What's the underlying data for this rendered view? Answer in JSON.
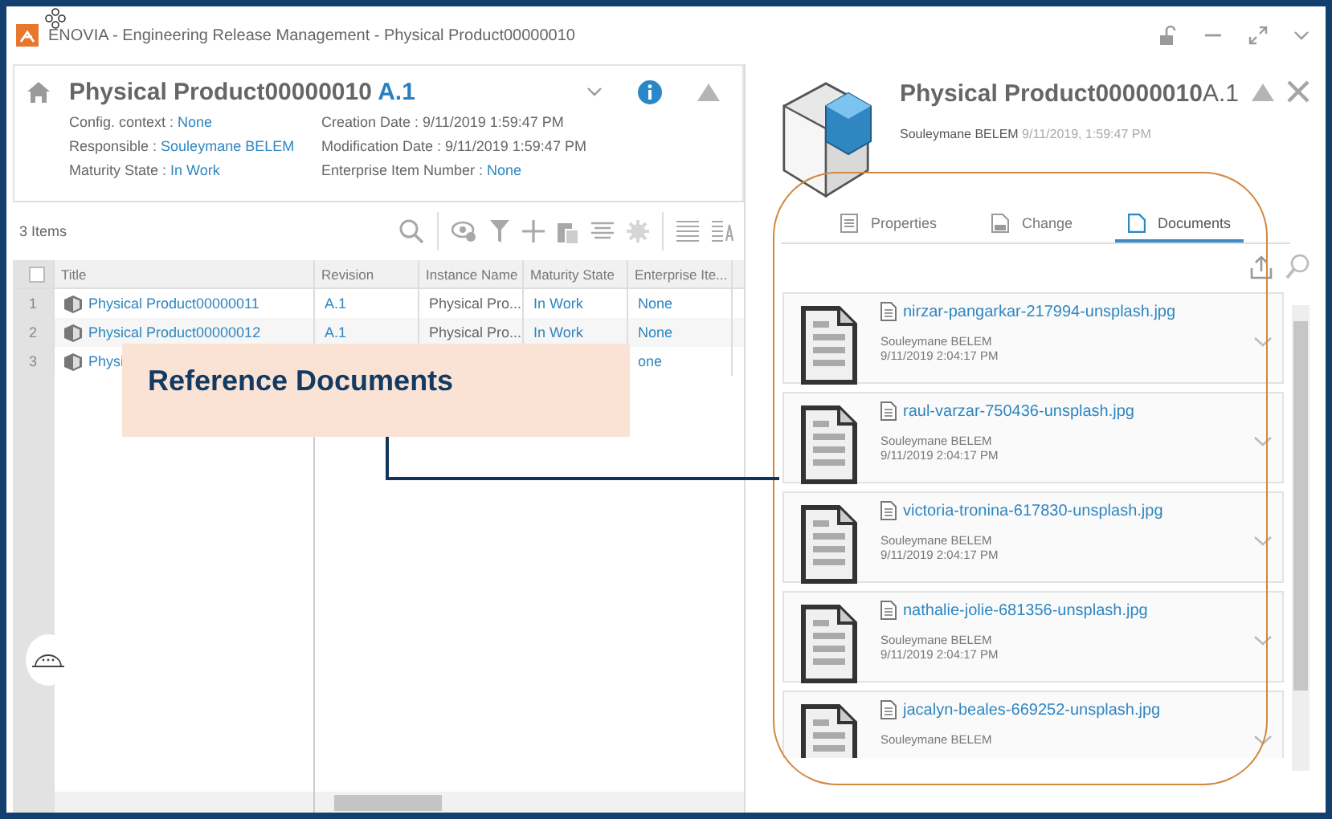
{
  "window": {
    "title": "ENOVIA - Engineering Release Management - Physical Product00000010"
  },
  "object_header": {
    "name": "Physical Product00000010",
    "revision": "A.1",
    "attributes": [
      {
        "label": "Config. context :",
        "value": "None",
        "kind": "link"
      },
      {
        "label": "Creation Date :",
        "value": "9/11/2019 1:59:47 PM",
        "kind": "text"
      },
      {
        "label": "Responsible :",
        "value": "Souleymane BELEM",
        "kind": "link"
      },
      {
        "label": "Modification Date :",
        "value": "9/11/2019 1:59:47 PM",
        "kind": "text"
      },
      {
        "label": "Maturity State :",
        "value": "In Work",
        "kind": "link"
      },
      {
        "label": "Enterprise Item Number :",
        "value": "None",
        "kind": "link"
      }
    ]
  },
  "toolbar": {
    "count": "3 Items"
  },
  "table": {
    "header_checked": false,
    "columns": [
      "Title",
      "Revision",
      "Instance Name",
      "Maturity State",
      "Enterprise Ite..."
    ],
    "rows": [
      {
        "number": "1",
        "cells": [
          "Physical Product00000011",
          "A.1",
          "Physical Pro...",
          "In Work",
          "None"
        ]
      },
      {
        "number": "2",
        "cells": [
          "Physical Product00000012",
          "A.1",
          "Physical Pro...",
          "In Work",
          "None"
        ]
      },
      {
        "number": "3",
        "cells": [
          "Physi",
          null,
          null,
          null,
          "one"
        ]
      }
    ]
  },
  "details_panel": {
    "name": "Physical Product00000010",
    "revision": "A.1",
    "author": "Souleymane BELEM",
    "date": "9/11/2019, 1:59:47 PM"
  },
  "tabs": [
    {
      "label": "Properties",
      "selected": false,
      "kind": "list"
    },
    {
      "label": "Change",
      "selected": false,
      "kind": "page"
    },
    {
      "label": "Documents",
      "selected": true,
      "kind": "doc"
    }
  ],
  "documents": [
    {
      "name": "nirzar-pangarkar-217994-unsplash.jpg",
      "author": "Souleymane BELEM",
      "date": "9/11/2019 2:04:17 PM"
    },
    {
      "name": "raul-varzar-750436-unsplash.jpg",
      "author": "Souleymane BELEM",
      "date": "9/11/2019 2:04:17 PM"
    },
    {
      "name": "victoria-tronina-617830-unsplash.jpg",
      "author": "Souleymane BELEM",
      "date": "9/11/2019 2:04:17 PM"
    },
    {
      "name": "nathalie-jolie-681356-unsplash.jpg",
      "author": "Souleymane BELEM",
      "date": "9/11/2019 2:04:17 PM"
    },
    {
      "name": "jacalyn-beales-669252-unsplash.jpg",
      "author": "Souleymane BELEM"
    }
  ],
  "callout": {
    "text": "Reference Documents"
  }
}
